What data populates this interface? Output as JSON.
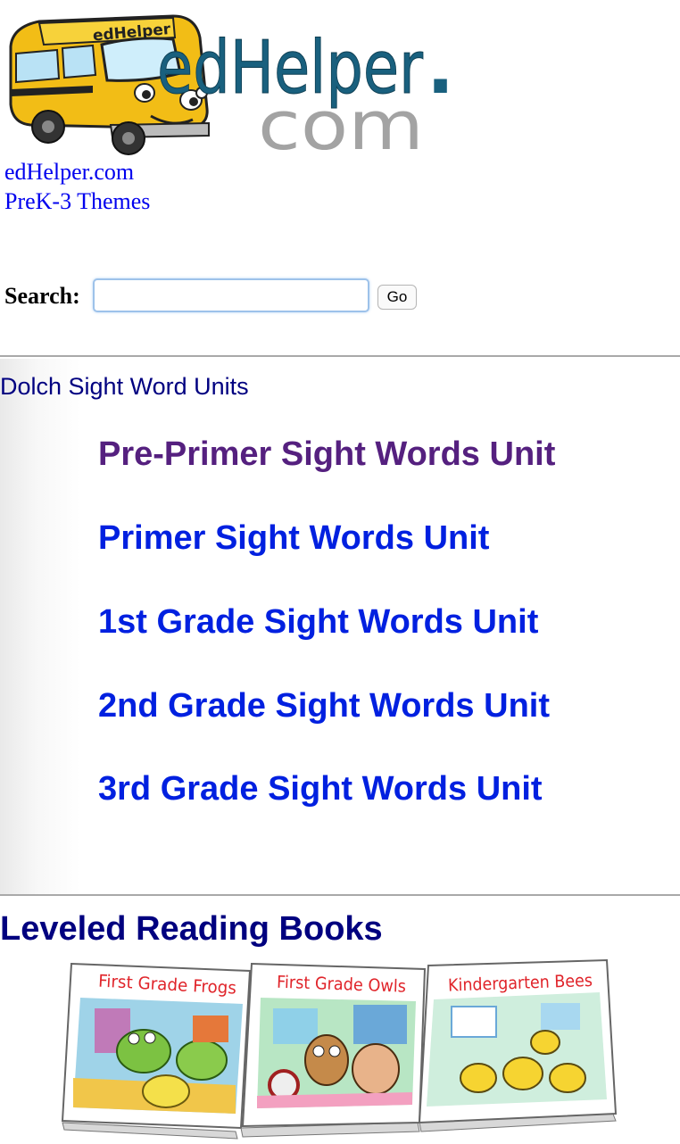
{
  "logo": {
    "bus_label": "edHelper",
    "word1": "edHelper",
    "dot": ".",
    "word2": "com"
  },
  "links": {
    "site": "edHelper.com",
    "themes": "PreK-3 Themes"
  },
  "search": {
    "label": "Search:",
    "value": "",
    "button_label": "Go"
  },
  "dolch": {
    "title": "Dolch Sight Word Units",
    "units": [
      {
        "label": "Pre-Primer Sight Words Unit",
        "visited": true
      },
      {
        "label": "Primer Sight Words Unit",
        "visited": false
      },
      {
        "label": "1st Grade Sight Words Unit",
        "visited": false
      },
      {
        "label": "2nd Grade Sight Words Unit",
        "visited": false
      },
      {
        "label": "3rd Grade Sight Words Unit",
        "visited": false
      }
    ]
  },
  "leveled": {
    "title": "Leveled Reading Books",
    "books": [
      {
        "title": "First Grade Frogs"
      },
      {
        "title": "First Grade Owls"
      },
      {
        "title": "Kindergarten Bees"
      }
    ]
  },
  "colors": {
    "link": "#0020e0",
    "visited": "#55207f",
    "heading": "#00007f",
    "bus": "#f5c400"
  }
}
